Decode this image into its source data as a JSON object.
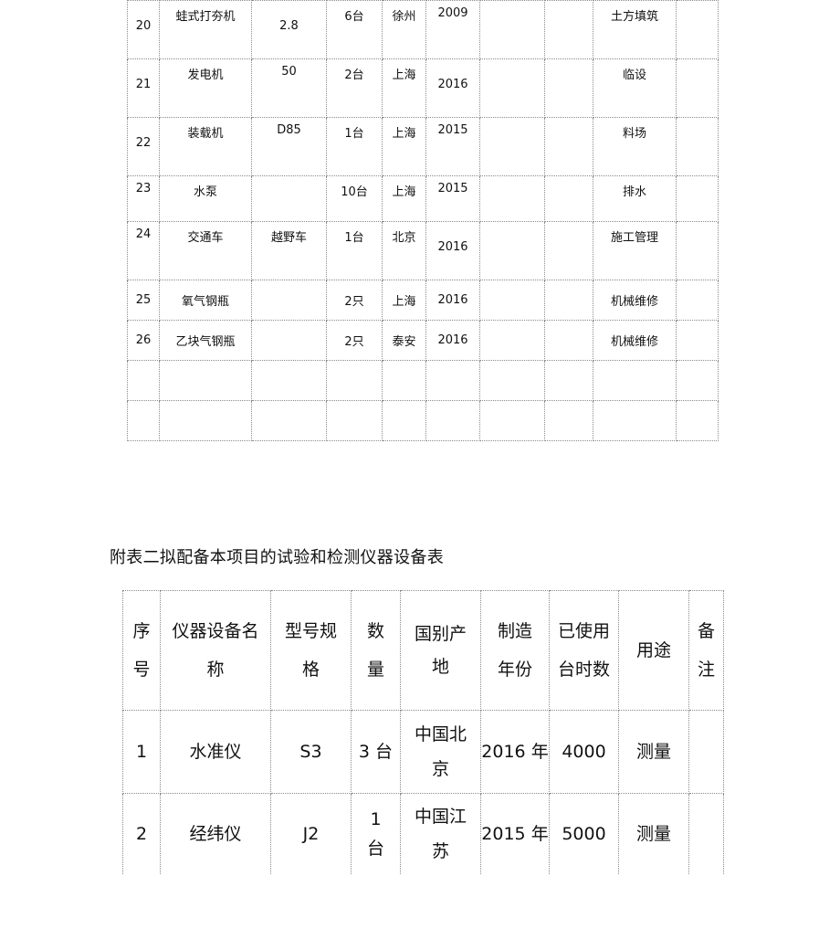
{
  "table1": {
    "rows": [
      {
        "no": "20",
        "name": "蛙式打夯机",
        "spec": "2.8",
        "qty": "6台",
        "origin": "徐州",
        "year": "2009",
        "power": "",
        "capacity": "",
        "use": "土方填筑",
        "remark": ""
      },
      {
        "no": "21",
        "name": "发电机",
        "spec": "50",
        "qty": "2台",
        "origin": "上海",
        "year": "2016",
        "power": "",
        "capacity": "",
        "use": "临设",
        "remark": ""
      },
      {
        "no": "22",
        "name": "装载机",
        "spec": "D85",
        "qty": "1台",
        "origin": "上海",
        "year": "2015",
        "power": "",
        "capacity": "",
        "use": "料场",
        "remark": ""
      },
      {
        "no": "23",
        "name": "水泵",
        "spec": "",
        "qty": "10台",
        "origin": "上海",
        "year": "2015",
        "power": "",
        "capacity": "",
        "use": "排水",
        "remark": ""
      },
      {
        "no": "24",
        "name": "交通车",
        "spec": "越野车",
        "qty": "1台",
        "origin": "北京",
        "year": "2016",
        "power": "",
        "capacity": "",
        "use": "施工管理",
        "remark": ""
      },
      {
        "no": "25",
        "name": "氧气钢瓶",
        "spec": "",
        "qty": "2只",
        "origin": "上海",
        "year": "2016",
        "power": "",
        "capacity": "",
        "use": "机械维修",
        "remark": ""
      },
      {
        "no": "26",
        "name": "乙块气钢瓶",
        "spec": "",
        "qty": "2只",
        "origin": "泰安",
        "year": "2016",
        "power": "",
        "capacity": "",
        "use": "机械维修",
        "remark": ""
      }
    ]
  },
  "table2": {
    "title": "附表二拟配备本项目的试验和检测仪器设备表",
    "headers": {
      "no": [
        "序",
        "号"
      ],
      "name": [
        "仪器设备名",
        "称"
      ],
      "spec": [
        "型号规",
        "格"
      ],
      "qty": [
        "数",
        "量"
      ],
      "origin": [
        "国别产",
        "地"
      ],
      "year": [
        "制造",
        "年份"
      ],
      "hours": [
        "已使用",
        "台时数"
      ],
      "use": "用途",
      "remark": [
        "备",
        "注"
      ]
    },
    "rows": [
      {
        "no": "1",
        "name": "水准仪",
        "spec": "S3",
        "qty": "3 台",
        "origin": [
          "中国北",
          "京"
        ],
        "year": "2016 年",
        "hours": "4000",
        "use": "测量",
        "remark": ""
      },
      {
        "no": "2",
        "name": "经纬仪",
        "spec": "J2",
        "qty": [
          "1",
          "台"
        ],
        "origin": [
          "中国江",
          "苏"
        ],
        "year": "2015 年",
        "hours": "5000",
        "use": "测量",
        "remark": ""
      }
    ]
  }
}
